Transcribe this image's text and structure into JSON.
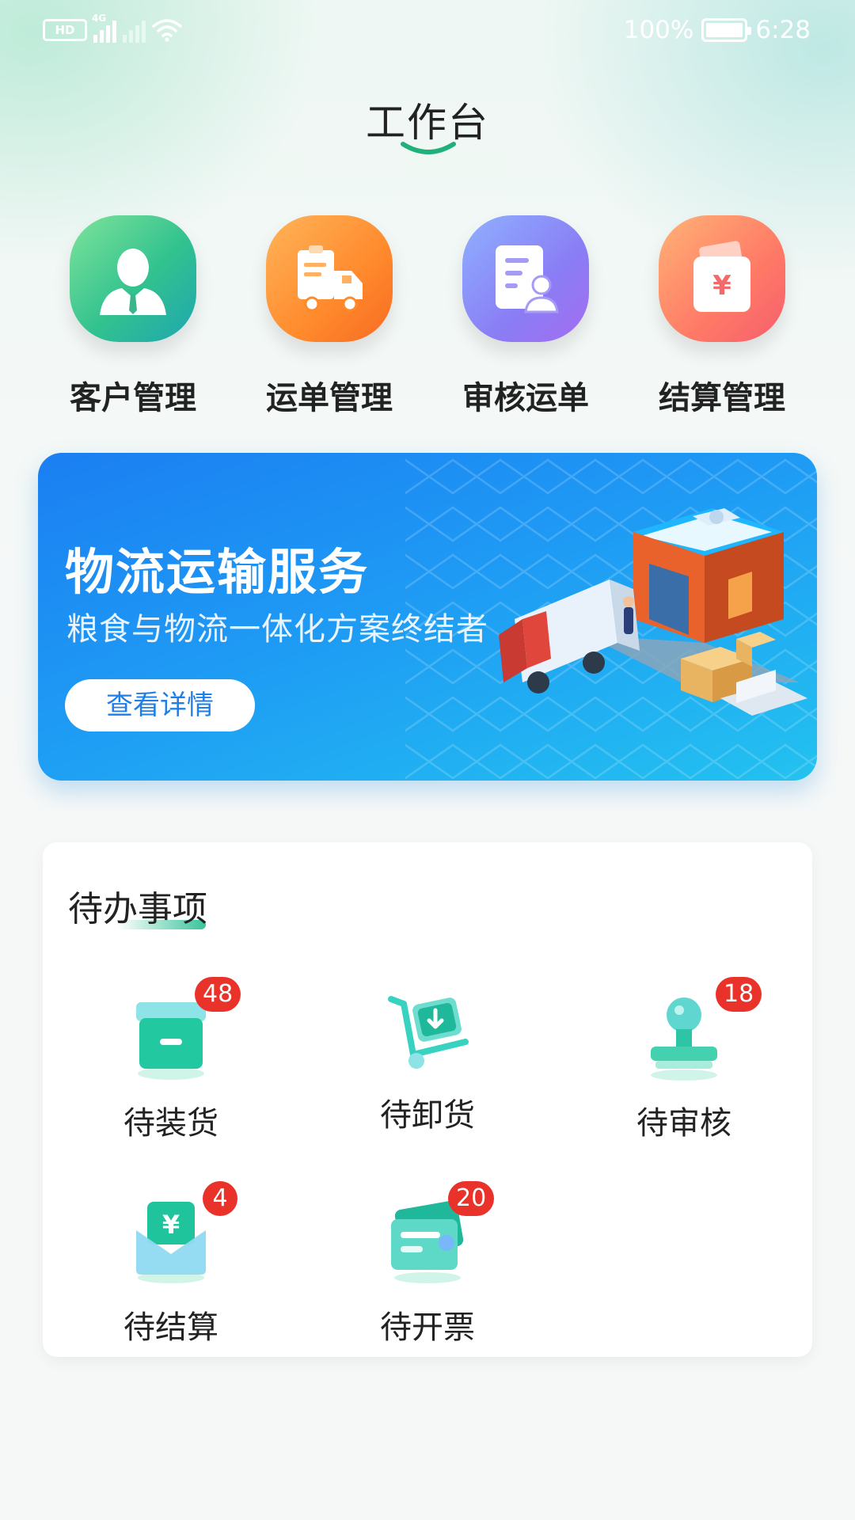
{
  "status_bar": {
    "network_label": "4G",
    "battery_text": "100%",
    "time": "6:28"
  },
  "header": {
    "title": "工作台"
  },
  "quick_menu": [
    {
      "label": "客户管理",
      "icon": "customer-icon",
      "color": "#32c28f"
    },
    {
      "label": "运单管理",
      "icon": "truck-clipboard-icon",
      "color": "#ff8a2c"
    },
    {
      "label": "审核运单",
      "icon": "document-user-icon",
      "color": "#8a7df5"
    },
    {
      "label": "结算管理",
      "icon": "yuan-wallet-icon",
      "color": "#ff7a66"
    }
  ],
  "banner": {
    "title": "物流运输服务",
    "subtitle": "粮食与物流一体化方案终结者",
    "button_label": "查看详情"
  },
  "todo": {
    "title": "待办事项",
    "items": [
      {
        "label": "待装货",
        "badge": "48",
        "icon": "box-icon"
      },
      {
        "label": "待卸货",
        "badge": "",
        "icon": "hand-truck-icon"
      },
      {
        "label": "待审核",
        "badge": "18",
        "icon": "stamp-icon"
      },
      {
        "label": "待结算",
        "badge": "4",
        "icon": "yuan-envelope-icon"
      },
      {
        "label": "待开票",
        "badge": "20",
        "icon": "invoice-card-icon"
      }
    ]
  },
  "colors": {
    "accent": "#39c49a",
    "badge": "#e8322a",
    "banner": "#1e9af4"
  }
}
